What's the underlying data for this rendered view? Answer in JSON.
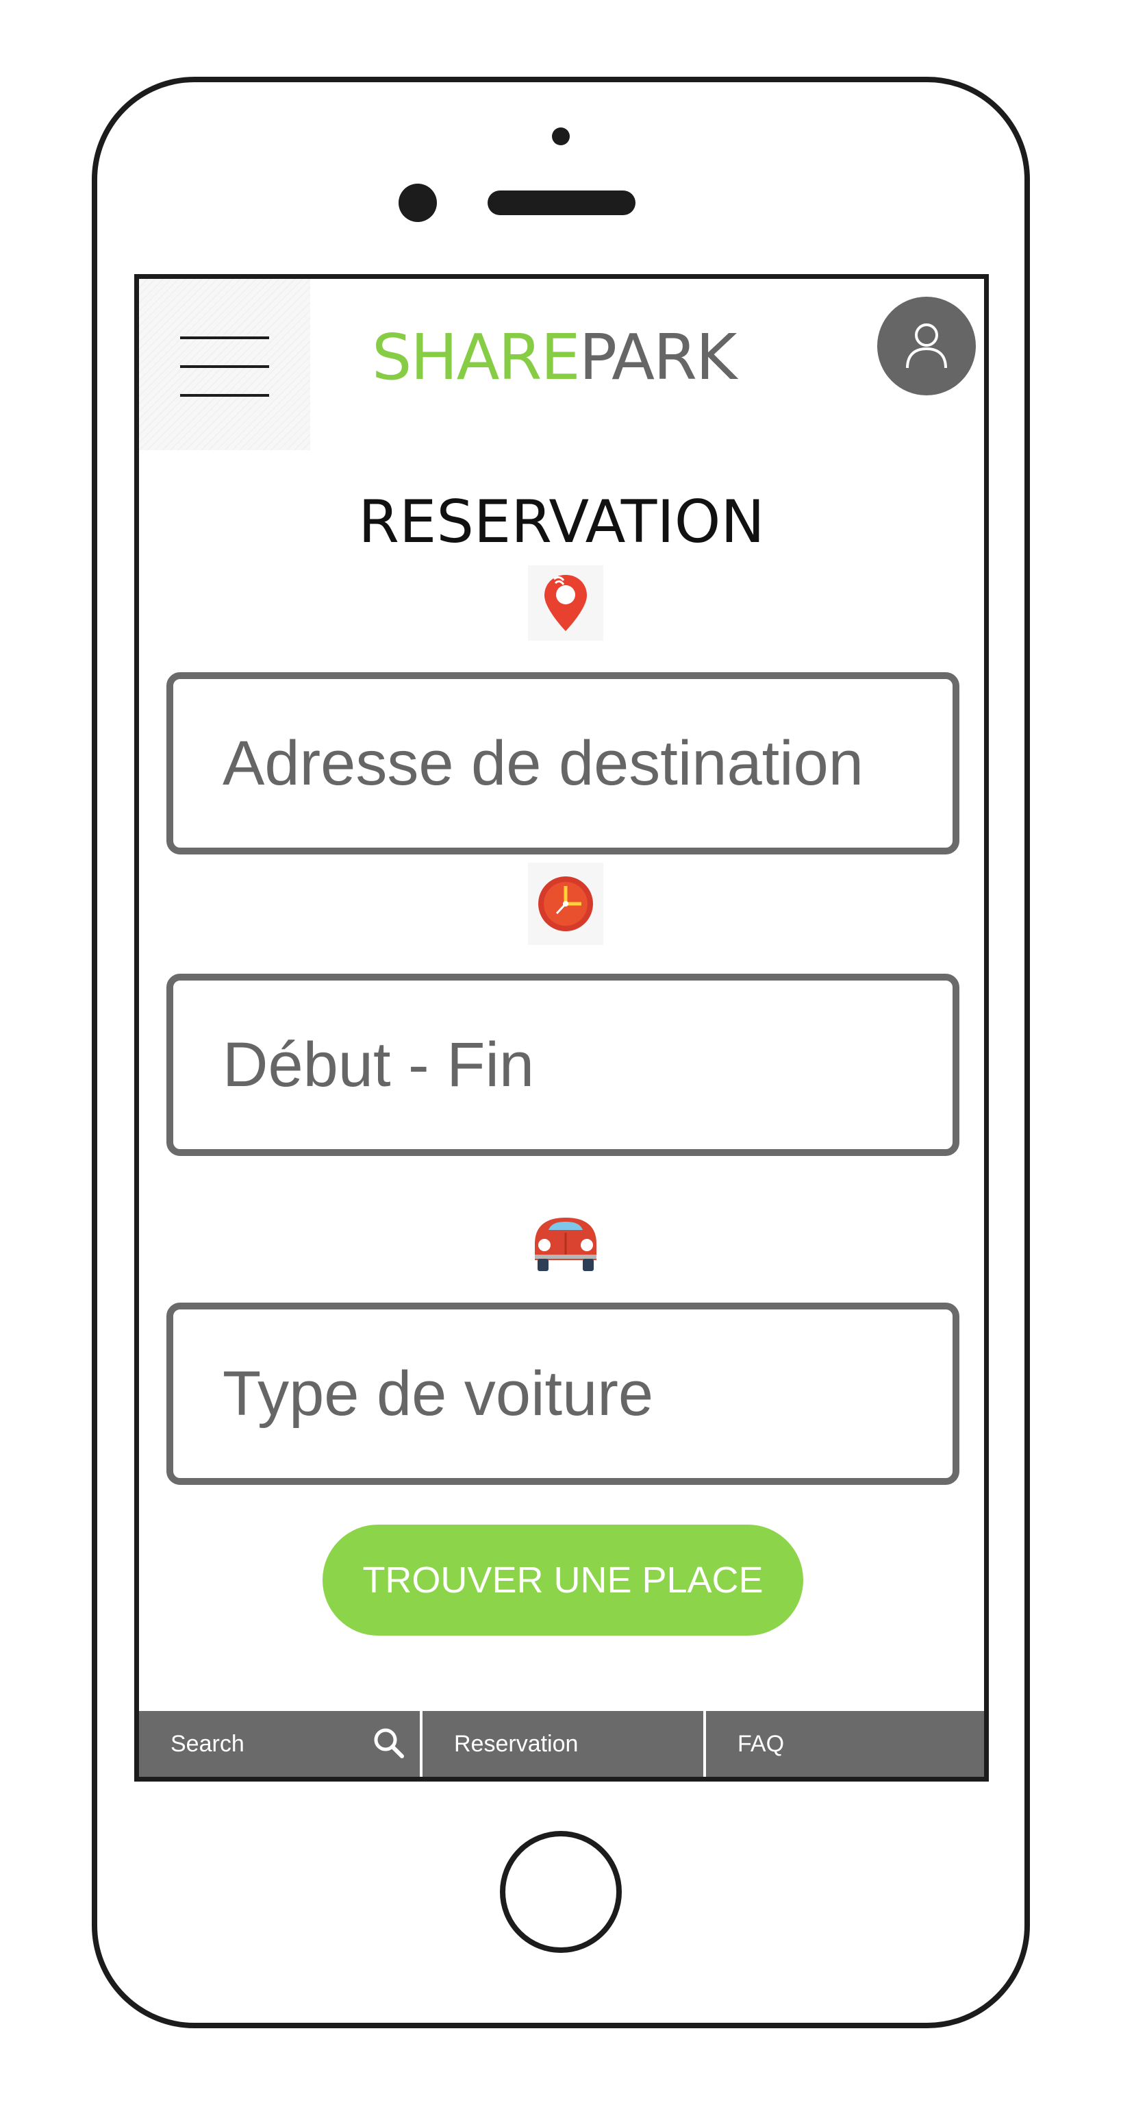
{
  "header": {
    "brand_part1": "SHARE",
    "brand_part2": "PARK",
    "menu_icon": "hamburger-menu-icon",
    "avatar_icon": "user-icon"
  },
  "page": {
    "title": "RESERVATION"
  },
  "form": {
    "destination": {
      "icon": "location-pin-icon",
      "placeholder": "Adresse de destination"
    },
    "time": {
      "icon": "clock-icon",
      "placeholder": "Début - Fin"
    },
    "car": {
      "icon": "car-icon",
      "placeholder": "Type de voiture"
    },
    "submit_label": "TROUVER UNE PLACE"
  },
  "bottom_nav": {
    "tabs": [
      {
        "label": "Search",
        "icon": "search-icon"
      },
      {
        "label": "Reservation"
      },
      {
        "label": "FAQ"
      }
    ]
  },
  "colors": {
    "brand_green": "#86cc45",
    "button_green": "#8cd44a",
    "brand_gray": "#666666",
    "nav_gray": "#6a6a6a",
    "pin_red": "#e8412f",
    "clock_red": "#d63a2a",
    "car_red": "#d9432f"
  }
}
